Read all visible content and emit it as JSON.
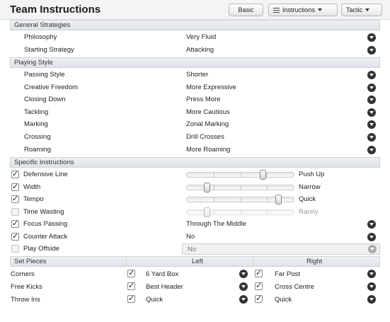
{
  "header": {
    "title": "Team Instructions",
    "basic_label": "Basic",
    "instructions_label": "Instructions",
    "tactic_label": "Tactic"
  },
  "general_strategies": {
    "heading": "General Strategies",
    "rows": [
      {
        "label": "Philosophy",
        "value": "Very Fluid"
      },
      {
        "label": "Starting Strategy",
        "value": "Attacking"
      }
    ]
  },
  "playing_style": {
    "heading": "Playing Style",
    "rows": [
      {
        "label": "Passing Style",
        "value": "Shorter"
      },
      {
        "label": "Creative Freedom",
        "value": "More Expressive"
      },
      {
        "label": "Closing Down",
        "value": "Press More"
      },
      {
        "label": "Tackling",
        "value": "More Cautious"
      },
      {
        "label": "Marking",
        "value": "Zonal Marking"
      },
      {
        "label": "Crossing",
        "value": "Drill Crosses"
      },
      {
        "label": "Roaming",
        "value": "More Roaming"
      }
    ]
  },
  "specific_instructions": {
    "heading": "Specific Instructions",
    "sliders": [
      {
        "label": "Defensive Line",
        "checked": true,
        "level": 0.71,
        "value": "Push Up"
      },
      {
        "label": "Width",
        "checked": true,
        "level": 0.19,
        "value": "Narrow"
      },
      {
        "label": "Tempo",
        "checked": true,
        "level": 0.86,
        "value": "Quick"
      },
      {
        "label": "Time Wasting",
        "checked": false,
        "level": 0.19,
        "value": "Rarely"
      }
    ],
    "dropdowns": [
      {
        "label": "Focus Passing",
        "checked": true,
        "value": "Through The Middle"
      },
      {
        "label": "Counter Attack",
        "checked": true,
        "value": "No"
      },
      {
        "label": "Play Offside",
        "checked": false,
        "value": "No"
      }
    ]
  },
  "set_pieces": {
    "heading": "Set Pieces",
    "left_heading": "Left",
    "right_heading": "Right",
    "rows": [
      {
        "label": "Corners",
        "left": "6 Yard Box",
        "right": "Far Post"
      },
      {
        "label": "Free Kicks",
        "left": "Best Header",
        "right": "Cross Centre"
      },
      {
        "label": "Throw Ins",
        "left": "Quick",
        "right": "Quick"
      }
    ]
  }
}
